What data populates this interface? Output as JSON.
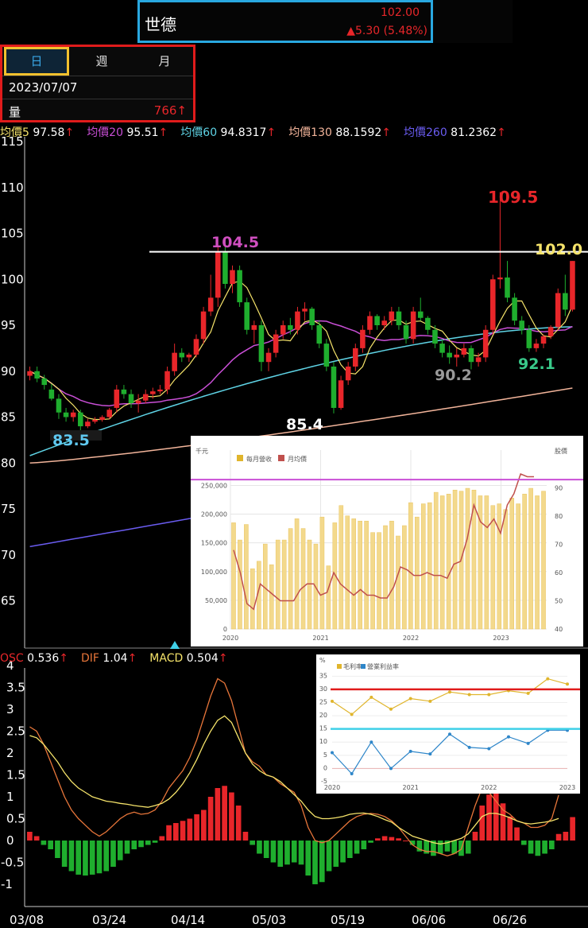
{
  "header": {
    "stock_name": "世德",
    "price": "102.00",
    "change": "▲5.30 (5.48%)"
  },
  "period_tabs": [
    {
      "label": "日",
      "selected": true
    },
    {
      "label": "週",
      "selected": false
    },
    {
      "label": "月",
      "selected": false
    }
  ],
  "info": {
    "date": "2023/07/07",
    "volume_label": "量",
    "volume_value": "766↑"
  },
  "ma_legend": [
    {
      "name": "均價5",
      "value": "97.58",
      "arrow": "↑",
      "color": "#f5e36a"
    },
    {
      "name": "均價20",
      "value": "95.51",
      "arrow": "↑",
      "color": "#c94fd6"
    },
    {
      "name": "均價60",
      "value": "94.8317",
      "arrow": "↑",
      "color": "#5fd4e6"
    },
    {
      "name": "均價130",
      "value": "88.1592",
      "arrow": "↑",
      "color": "#f2b49a"
    },
    {
      "name": "均價260",
      "value": "81.2362",
      "arrow": "↑",
      "color": "#6a5cf0"
    }
  ],
  "macd_legend": [
    {
      "name": "OSC",
      "value": "0.536",
      "arrow": "↑",
      "color": "#e8262a"
    },
    {
      "name": "DIF",
      "value": "1.04",
      "arrow": "↑",
      "color": "#e8763a"
    },
    {
      "name": "MACD",
      "value": "0.504",
      "arrow": "↑",
      "color": "#f5e36a"
    }
  ],
  "annotations": {
    "high_left": "104.5",
    "high_right": "109.5",
    "last": "102.0",
    "low_1": "83.5",
    "low_2": "85.4",
    "low_3": "90.2",
    "low_4": "92.1"
  },
  "colors": {
    "up": "#e8262a",
    "down": "#1fae2e",
    "resistance": "#ffffff",
    "inset_purple": "#c94fd6",
    "inset_red": "#e01b1b",
    "inset_cyan": "#3fd0e8"
  },
  "chart_data": [
    {
      "type": "candlestick",
      "title": "",
      "x_tick_labels": [
        "03/08",
        "03/24",
        "04/14",
        "05/03",
        "05/19",
        "06/06",
        "06/26"
      ],
      "y_ticks": [
        "115",
        "110",
        "105",
        "100",
        "95",
        "90",
        "85",
        "80",
        "75",
        "70",
        "65"
      ],
      "ylim": [
        62,
        115
      ],
      "resistance_line": 103,
      "candles": [
        [
          89.5,
          90.5,
          89.0,
          90.0
        ],
        [
          90.0,
          90.5,
          88.8,
          89.2
        ],
        [
          89.2,
          89.6,
          88.0,
          88.5
        ],
        [
          88.0,
          88.6,
          86.8,
          87.0
        ],
        [
          87.0,
          87.5,
          84.8,
          85.5
        ],
        [
          85.5,
          86.0,
          84.5,
          85.0
        ],
        [
          85.0,
          85.8,
          84.5,
          85.5
        ],
        [
          85.5,
          85.8,
          83.5,
          84.0
        ],
        [
          84.0,
          84.8,
          83.8,
          84.5
        ],
        [
          84.5,
          85.0,
          84.3,
          84.7
        ],
        [
          84.7,
          85.2,
          84.5,
          85.0
        ],
        [
          85.0,
          86.0,
          84.8,
          85.8
        ],
        [
          86.0,
          88.5,
          85.5,
          88.0
        ],
        [
          88.0,
          88.5,
          87.0,
          87.5
        ],
        [
          87.5,
          88.0,
          86.0,
          86.5
        ],
        [
          86.5,
          87.5,
          85.5,
          86.8
        ],
        [
          86.8,
          88.0,
          86.5,
          87.5
        ],
        [
          87.5,
          88.2,
          87.0,
          87.8
        ],
        [
          87.8,
          88.5,
          87.5,
          88.0
        ],
        [
          88.0,
          90.5,
          87.5,
          90.0
        ],
        [
          90.0,
          93.0,
          89.5,
          92.0
        ],
        [
          92.0,
          92.5,
          91.0,
          91.5
        ],
        [
          91.5,
          92.0,
          91.0,
          91.8
        ],
        [
          91.8,
          94.0,
          91.5,
          93.5
        ],
        [
          93.5,
          97.0,
          93.0,
          96.5
        ],
        [
          96.5,
          100.5,
          96.0,
          98.0
        ],
        [
          98.0,
          103.5,
          97.0,
          103.0
        ],
        [
          103.0,
          104.5,
          99.0,
          99.5
        ],
        [
          99.5,
          101.5,
          98.5,
          101.0
        ],
        [
          101.0,
          101.5,
          97.0,
          97.5
        ],
        [
          97.5,
          98.0,
          94.0,
          94.5
        ],
        [
          94.5,
          95.5,
          93.0,
          95.0
        ],
        [
          95.0,
          95.5,
          90.0,
          91.0
        ],
        [
          91.0,
          92.5,
          90.0,
          92.0
        ],
        [
          92.0,
          94.5,
          91.5,
          94.0
        ],
        [
          94.0,
          95.5,
          93.5,
          95.0
        ],
        [
          95.0,
          95.8,
          94.0,
          94.5
        ],
        [
          94.5,
          97.0,
          94.0,
          96.5
        ],
        [
          96.5,
          97.5,
          95.5,
          96.8
        ],
        [
          96.8,
          97.0,
          94.5,
          95.0
        ],
        [
          95.0,
          95.5,
          92.5,
          93.0
        ],
        [
          93.0,
          93.5,
          90.0,
          90.5
        ],
        [
          90.5,
          91.0,
          85.4,
          86.0
        ],
        [
          86.0,
          89.5,
          85.8,
          89.0
        ],
        [
          89.0,
          91.0,
          88.5,
          90.5
        ],
        [
          90.5,
          93.0,
          90.0,
          92.5
        ],
        [
          92.5,
          95.0,
          92.0,
          94.5
        ],
        [
          94.5,
          96.5,
          94.0,
          96.0
        ],
        [
          96.0,
          96.2,
          94.5,
          95.0
        ],
        [
          95.0,
          96.0,
          94.5,
          95.5
        ],
        [
          95.5,
          97.0,
          95.0,
          96.5
        ],
        [
          96.5,
          97.0,
          94.5,
          95.0
        ],
        [
          95.0,
          95.5,
          93.0,
          93.5
        ],
        [
          93.5,
          97.0,
          93.0,
          96.5
        ],
        [
          96.5,
          98.0,
          95.5,
          95.8
        ],
        [
          95.8,
          96.0,
          94.0,
          94.5
        ],
        [
          94.5,
          95.0,
          92.5,
          93.0
        ],
        [
          93.0,
          93.5,
          91.5,
          92.0
        ],
        [
          92.0,
          92.8,
          90.8,
          91.5
        ],
        [
          91.5,
          92.5,
          90.5,
          91.8
        ],
        [
          91.8,
          93.0,
          91.5,
          92.5
        ],
        [
          92.5,
          92.8,
          90.2,
          91.0
        ],
        [
          91.0,
          92.0,
          90.5,
          91.5
        ],
        [
          91.5,
          95.0,
          91.0,
          94.5
        ],
        [
          94.5,
          100.5,
          94.0,
          100.0
        ],
        [
          100.0,
          109.5,
          99.0,
          100.2
        ],
        [
          100.2,
          102.0,
          97.5,
          98.0
        ],
        [
          98.0,
          98.5,
          95.0,
          95.5
        ],
        [
          95.5,
          96.0,
          94.0,
          94.5
        ],
        [
          94.5,
          95.0,
          92.1,
          92.5
        ],
        [
          92.5,
          93.5,
          92.1,
          93.0
        ],
        [
          93.0,
          94.0,
          92.5,
          93.8
        ],
        [
          93.8,
          95.0,
          93.5,
          94.8
        ],
        [
          94.8,
          99.0,
          94.5,
          98.5
        ],
        [
          98.5,
          100.5,
          96.0,
          96.7
        ],
        [
          96.7,
          102.0,
          96.5,
          102.0
        ]
      ],
      "ma5_label_series": "均價5",
      "ma20_label_series": "均價20",
      "ma60_label_series": "均價60",
      "ma130_label_series": "均價130",
      "ma260_label_series": "均價260"
    },
    {
      "type": "bar",
      "title": "",
      "y_ticks": [
        "4",
        "3.5",
        "3",
        "2.5",
        "2",
        "1.5",
        "1",
        "0.5",
        "0",
        "-0.5",
        "-1"
      ],
      "ylim": [
        -1.1,
        4
      ],
      "series": [
        {
          "name": "OSC",
          "values": [
            0.2,
            0.1,
            -0.1,
            -0.2,
            -0.4,
            -0.6,
            -0.7,
            -0.78,
            -0.8,
            -0.78,
            -0.75,
            -0.7,
            -0.6,
            -0.45,
            -0.3,
            -0.2,
            -0.15,
            -0.1,
            -0.05,
            0.1,
            0.35,
            0.4,
            0.45,
            0.5,
            0.6,
            0.7,
            1.0,
            1.2,
            1.25,
            1.1,
            0.8,
            0.2,
            -0.1,
            -0.3,
            -0.4,
            -0.5,
            -0.6,
            -0.55,
            -0.5,
            -0.55,
            -0.8,
            -1.0,
            -0.95,
            -0.7,
            -0.6,
            -0.5,
            -0.4,
            -0.3,
            -0.2,
            -0.05,
            0.05,
            0.1,
            0.08,
            0.05,
            0.0,
            -0.1,
            -0.25,
            -0.3,
            -0.35,
            -0.3,
            -0.25,
            -0.3,
            -0.35,
            -0.3,
            0.2,
            0.8,
            1.05,
            1.1,
            0.85,
            0.55,
            0.3,
            -0.1,
            -0.3,
            -0.35,
            -0.3,
            -0.2,
            0.15,
            0.2,
            0.536
          ]
        },
        {
          "name": "DIF",
          "values": [
            2.6,
            2.5,
            2.2,
            1.8,
            1.4,
            1.0,
            0.7,
            0.5,
            0.35,
            0.2,
            0.1,
            0.2,
            0.35,
            0.5,
            0.6,
            0.65,
            0.6,
            0.62,
            0.7,
            0.9,
            1.2,
            1.4,
            1.6,
            1.9,
            2.3,
            2.8,
            3.3,
            3.7,
            3.6,
            3.2,
            2.6,
            2.0,
            1.8,
            1.7,
            1.5,
            1.45,
            1.3,
            1.2,
            1.1,
            0.8,
            0.3,
            0.0,
            -0.05,
            0.0,
            0.15,
            0.3,
            0.45,
            0.55,
            0.6,
            0.62,
            0.6,
            0.55,
            0.45,
            0.3,
            0.1,
            -0.1,
            -0.2,
            -0.25,
            -0.25,
            -0.3,
            -0.35,
            -0.3,
            -0.2,
            0.3,
            0.8,
            1.2,
            1.1,
            0.9,
            0.7,
            0.6,
            0.45,
            0.4,
            0.3,
            0.3,
            0.35,
            0.5,
            1.04
          ]
        },
        {
          "name": "MACD",
          "values": [
            2.4,
            2.35,
            2.2,
            2.0,
            1.8,
            1.55,
            1.35,
            1.2,
            1.1,
            1.0,
            0.95,
            0.9,
            0.88,
            0.85,
            0.83,
            0.8,
            0.78,
            0.76,
            0.8,
            0.85,
            0.95,
            1.1,
            1.3,
            1.55,
            1.85,
            2.2,
            2.5,
            2.75,
            2.85,
            2.7,
            2.35,
            2.0,
            1.75,
            1.6,
            1.5,
            1.45,
            1.35,
            1.2,
            1.05,
            0.9,
            0.7,
            0.55,
            0.5,
            0.5,
            0.52,
            0.55,
            0.6,
            0.62,
            0.63,
            0.6,
            0.55,
            0.48,
            0.42,
            0.3,
            0.2,
            0.1,
            0.05,
            0.0,
            -0.05,
            -0.08,
            -0.05,
            0.0,
            0.05,
            0.15,
            0.35,
            0.55,
            0.62,
            0.62,
            0.58,
            0.52,
            0.45,
            0.4,
            0.38,
            0.4,
            0.42,
            0.45,
            0.504
          ]
        }
      ]
    },
    {
      "type": "bar",
      "title": "",
      "left_unit": "千元",
      "right_unit": "股價",
      "legend": [
        "每月營收",
        "月均價"
      ],
      "y_left_ticks": [
        "250,000",
        "200,000",
        "150,000",
        "100,000",
        "50,000",
        "0"
      ],
      "y_right_ticks": [
        "90",
        "80",
        "70",
        "60",
        "50",
        "40"
      ],
      "x_tick_labels": [
        "2020",
        "2021",
        "2022",
        "2023"
      ],
      "ylim_left": [
        0,
        270000
      ],
      "ylim_right": [
        40,
        95
      ],
      "series": [
        {
          "name": "每月營收",
          "values": [
            185000,
            155000,
            182000,
            105000,
            118000,
            148000,
            112000,
            155000,
            155000,
            175000,
            192000,
            175000,
            155000,
            148000,
            195000,
            110000,
            185000,
            215000,
            197000,
            192000,
            188000,
            188000,
            168000,
            168000,
            180000,
            188000,
            162000,
            180000,
            220000,
            195000,
            218000,
            220000,
            238000,
            232000,
            235000,
            242000,
            240000,
            245000,
            242000,
            232000,
            232000,
            215000,
            218000,
            208000,
            228000,
            218000,
            235000,
            245000,
            232000,
            240000
          ]
        },
        {
          "name": "月均價",
          "values": [
            68,
            60,
            49,
            47,
            56,
            54,
            52,
            50,
            50,
            50,
            54,
            56,
            56,
            52,
            53,
            60,
            56,
            54,
            52,
            54,
            52,
            52,
            51,
            51,
            55,
            62,
            61,
            59,
            59,
            60,
            59,
            59,
            58,
            63,
            64,
            72,
            84,
            78,
            76,
            79,
            74,
            84,
            88,
            95,
            94,
            94
          ]
        }
      ],
      "reference_line": 93
    },
    {
      "type": "line",
      "title": "",
      "y_unit": "%",
      "legend": [
        "毛利率",
        "營業利益率"
      ],
      "y_ticks": [
        "35",
        "30",
        "25",
        "20",
        "15",
        "10",
        "5",
        "0",
        "-5"
      ],
      "x_tick_labels": [
        "2020",
        "2021",
        "2022",
        "2023"
      ],
      "ylim": [
        -5,
        36
      ],
      "series": [
        {
          "name": "毛利率",
          "values": [
            25.5,
            20.5,
            27,
            22.5,
            26.5,
            25.5,
            29,
            28,
            28,
            29.5,
            28.5,
            34,
            32
          ]
        },
        {
          "name": "營業利益率",
          "values": [
            6,
            -2,
            10,
            0,
            6.5,
            5.5,
            13,
            8,
            7.5,
            12,
            9.5,
            14.5,
            14.5
          ]
        }
      ],
      "reference_lines": [
        30,
        15
      ]
    }
  ]
}
